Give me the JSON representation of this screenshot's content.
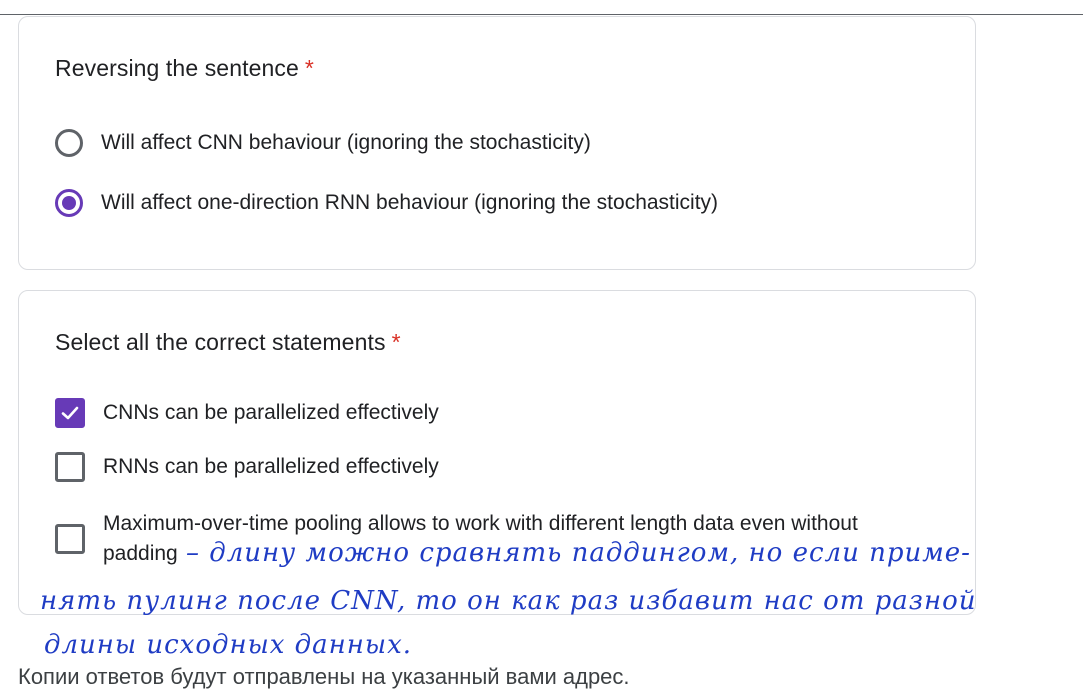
{
  "question1": {
    "title": "Reversing the sentence",
    "required_mark": "*",
    "options": [
      {
        "label": "Will affect CNN behaviour (ignoring the stochasticity)",
        "selected": false
      },
      {
        "label": "Will affect one-direction RNN behaviour (ignoring the stochasticity)",
        "selected": true
      }
    ]
  },
  "question2": {
    "title": "Select all the correct statements",
    "required_mark": "*",
    "options": [
      {
        "label": "CNNs can be parallelized effectively",
        "checked": true
      },
      {
        "label": "RNNs can be parallelized effectively",
        "checked": false
      },
      {
        "label": "Maximum-over-time pooling allows to work with different length data even without padding",
        "checked": false
      }
    ]
  },
  "handwritten_note": {
    "line1": "– длину можно сравнять паддингом, но если приме-",
    "line2": "нять пулинг после CNN, то он как раз избавит нас от разной",
    "line3": "длины исходных данных."
  },
  "footer_text": "Копии ответов будут отправлены на указанный вами адрес.",
  "colors": {
    "accent": "#673ab7",
    "required": "#d93025",
    "ink": "#1f3cc4"
  }
}
